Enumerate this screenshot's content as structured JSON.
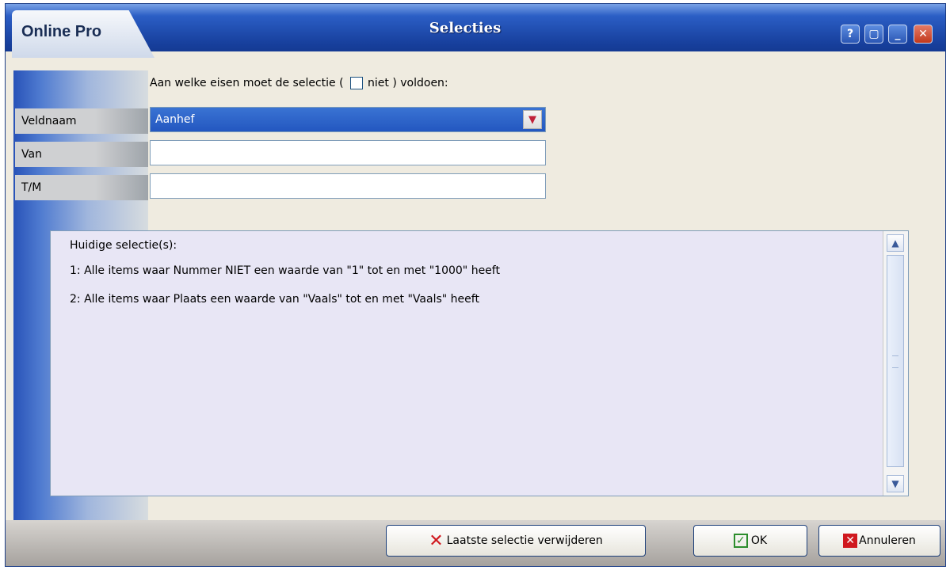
{
  "window": {
    "app_name": "Online Pro",
    "title": "Selecties",
    "controls": {
      "help_icon": "?",
      "restore_icon": "▢",
      "minimize_icon": "_",
      "close_icon": "✕"
    }
  },
  "form": {
    "question_before": "Aan welke eisen moet de selectie ( ",
    "niet_label": "niet",
    "question_after": " ) voldoen:",
    "niet_checked": false,
    "labels": {
      "veldnaam": "Veldnaam",
      "van": "Van",
      "tm": "T/M"
    },
    "veldnaam_value": "Aanhef",
    "van_value": "",
    "tm_value": ""
  },
  "selections": {
    "heading": "Huidige selectie(s):",
    "items": [
      "1: Alle items waar Nummer NIET een waarde van \"1\" tot en met \"1000\" heeft",
      "2: Alle items waar Plaats een waarde van \"Vaals\" tot en met \"Vaals\" heeft"
    ]
  },
  "buttons": {
    "remove_last": "Laatste selectie verwijderen",
    "ok": "OK",
    "cancel": "Annuleren"
  },
  "colors": {
    "titlebar": "#173f9c",
    "accent_red": "#d0181e",
    "ok_green": "#2c8d2c",
    "panel_bg": "#e8e6f5"
  }
}
